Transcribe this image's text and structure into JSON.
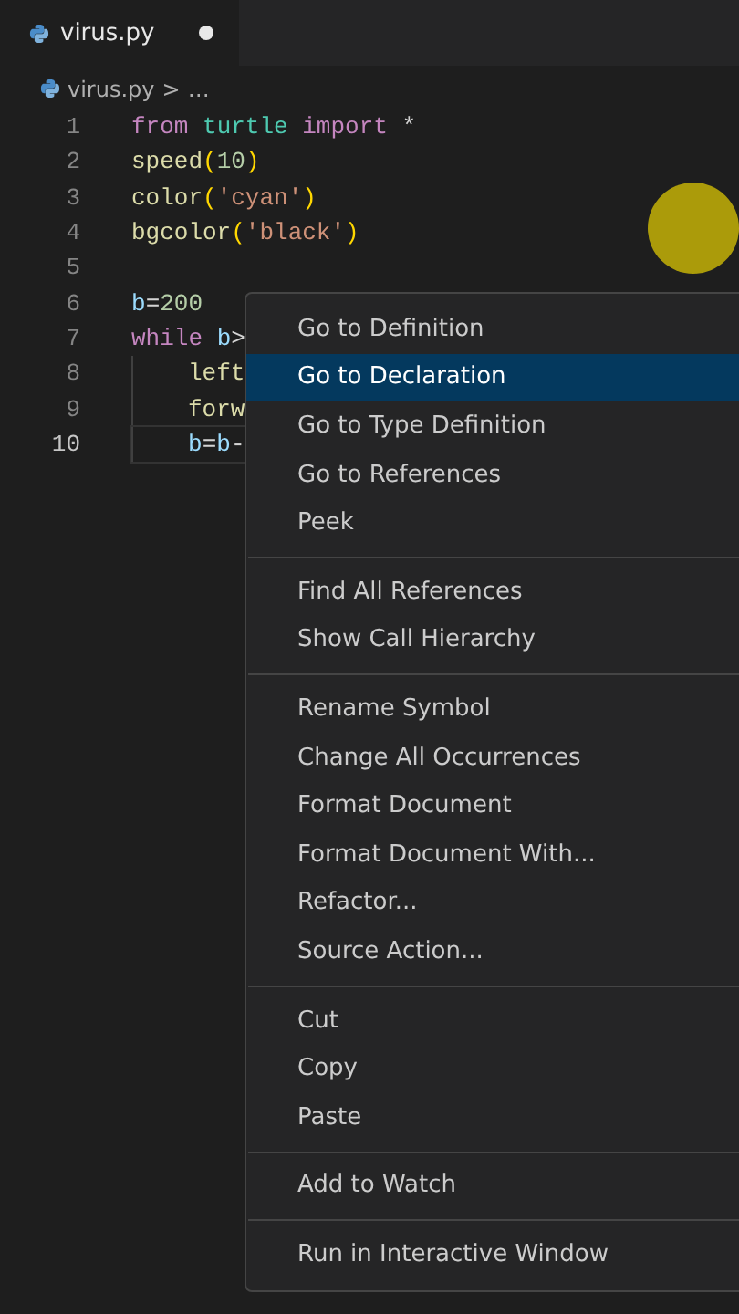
{
  "tab": {
    "label": "virus.py",
    "modified": true,
    "selected": true
  },
  "breadcrumb": {
    "file": "virus.py",
    "separator": ">",
    "more": "…"
  },
  "editor": {
    "lines": [
      {
        "number": "1",
        "indented": false,
        "current": false,
        "tokens": [
          {
            "kind": "keyword",
            "text": "from"
          },
          {
            "kind": "type",
            "text": "turtle",
            "spaced": true
          },
          {
            "kind": "keyword",
            "text": "import",
            "spaced": true
          },
          {
            "kind": "plain",
            "text": "*",
            "spaced": true
          }
        ]
      },
      {
        "number": "2",
        "indented": false,
        "current": false,
        "tokens": [
          {
            "kind": "function",
            "text": "speed"
          },
          {
            "kind": "bracket",
            "text": "("
          },
          {
            "kind": "number",
            "text": "10"
          },
          {
            "kind": "bracket",
            "text": ")"
          }
        ]
      },
      {
        "number": "3",
        "indented": false,
        "current": false,
        "tokens": [
          {
            "kind": "function",
            "text": "color"
          },
          {
            "kind": "bracket",
            "text": "("
          },
          {
            "kind": "string",
            "text": "'cyan'"
          },
          {
            "kind": "bracket",
            "text": ")"
          }
        ]
      },
      {
        "number": "4",
        "indented": false,
        "current": false,
        "tokens": [
          {
            "kind": "function",
            "text": "bgcolor"
          },
          {
            "kind": "bracket",
            "text": "("
          },
          {
            "kind": "string",
            "text": "'black'"
          },
          {
            "kind": "bracket",
            "text": ")"
          }
        ]
      },
      {
        "number": "5",
        "indented": false,
        "current": false
      },
      {
        "number": "6",
        "indented": false,
        "current": false,
        "tokens": [
          {
            "kind": "variable",
            "text": "b"
          },
          {
            "kind": "plain",
            "text": "="
          },
          {
            "kind": "number",
            "text": "200"
          }
        ]
      },
      {
        "number": "7",
        "indented": false,
        "current": false,
        "tokens": [
          {
            "kind": "keyword",
            "text": "while"
          },
          {
            "kind": "variable",
            "text": "b",
            "spaced": true
          },
          {
            "kind": "plain",
            "text": ">"
          }
        ]
      },
      {
        "number": "8",
        "indented": true,
        "current": false,
        "tokens": [
          {
            "kind": "function",
            "text": "left"
          }
        ]
      },
      {
        "number": "9",
        "indented": true,
        "current": false,
        "tokens": [
          {
            "kind": "function",
            "text": "forw"
          }
        ]
      },
      {
        "number": "10",
        "indented": true,
        "current": true,
        "tokens": [
          {
            "kind": "variable",
            "text": "b"
          },
          {
            "kind": "plain",
            "text": "="
          },
          {
            "kind": "variable",
            "text": "b"
          },
          {
            "kind": "plain",
            "text": "-"
          }
        ]
      }
    ]
  },
  "context_menu": {
    "groups": [
      [
        {
          "label": "Go to Definition",
          "selected": false
        },
        {
          "label": "Go to Declaration",
          "selected": true
        },
        {
          "label": "Go to Type Definition",
          "selected": false
        },
        {
          "label": "Go to References",
          "selected": false
        },
        {
          "label": "Peek",
          "selected": false
        }
      ],
      [
        {
          "label": "Find All References",
          "selected": false
        },
        {
          "label": "Show Call Hierarchy",
          "selected": false
        }
      ],
      [
        {
          "label": "Rename Symbol",
          "selected": false
        },
        {
          "label": "Change All Occurrences",
          "selected": false
        },
        {
          "label": "Format Document",
          "selected": false
        },
        {
          "label": "Format Document With...",
          "selected": false
        },
        {
          "label": "Refactor...",
          "selected": false
        },
        {
          "label": "Source Action...",
          "selected": false
        }
      ],
      [
        {
          "label": "Cut",
          "selected": false
        },
        {
          "label": "Copy",
          "selected": false
        },
        {
          "label": "Paste",
          "selected": false
        }
      ],
      [
        {
          "label": "Add to Watch",
          "selected": false
        }
      ],
      [
        {
          "label": "Run in Interactive Window",
          "selected": false
        }
      ]
    ]
  }
}
